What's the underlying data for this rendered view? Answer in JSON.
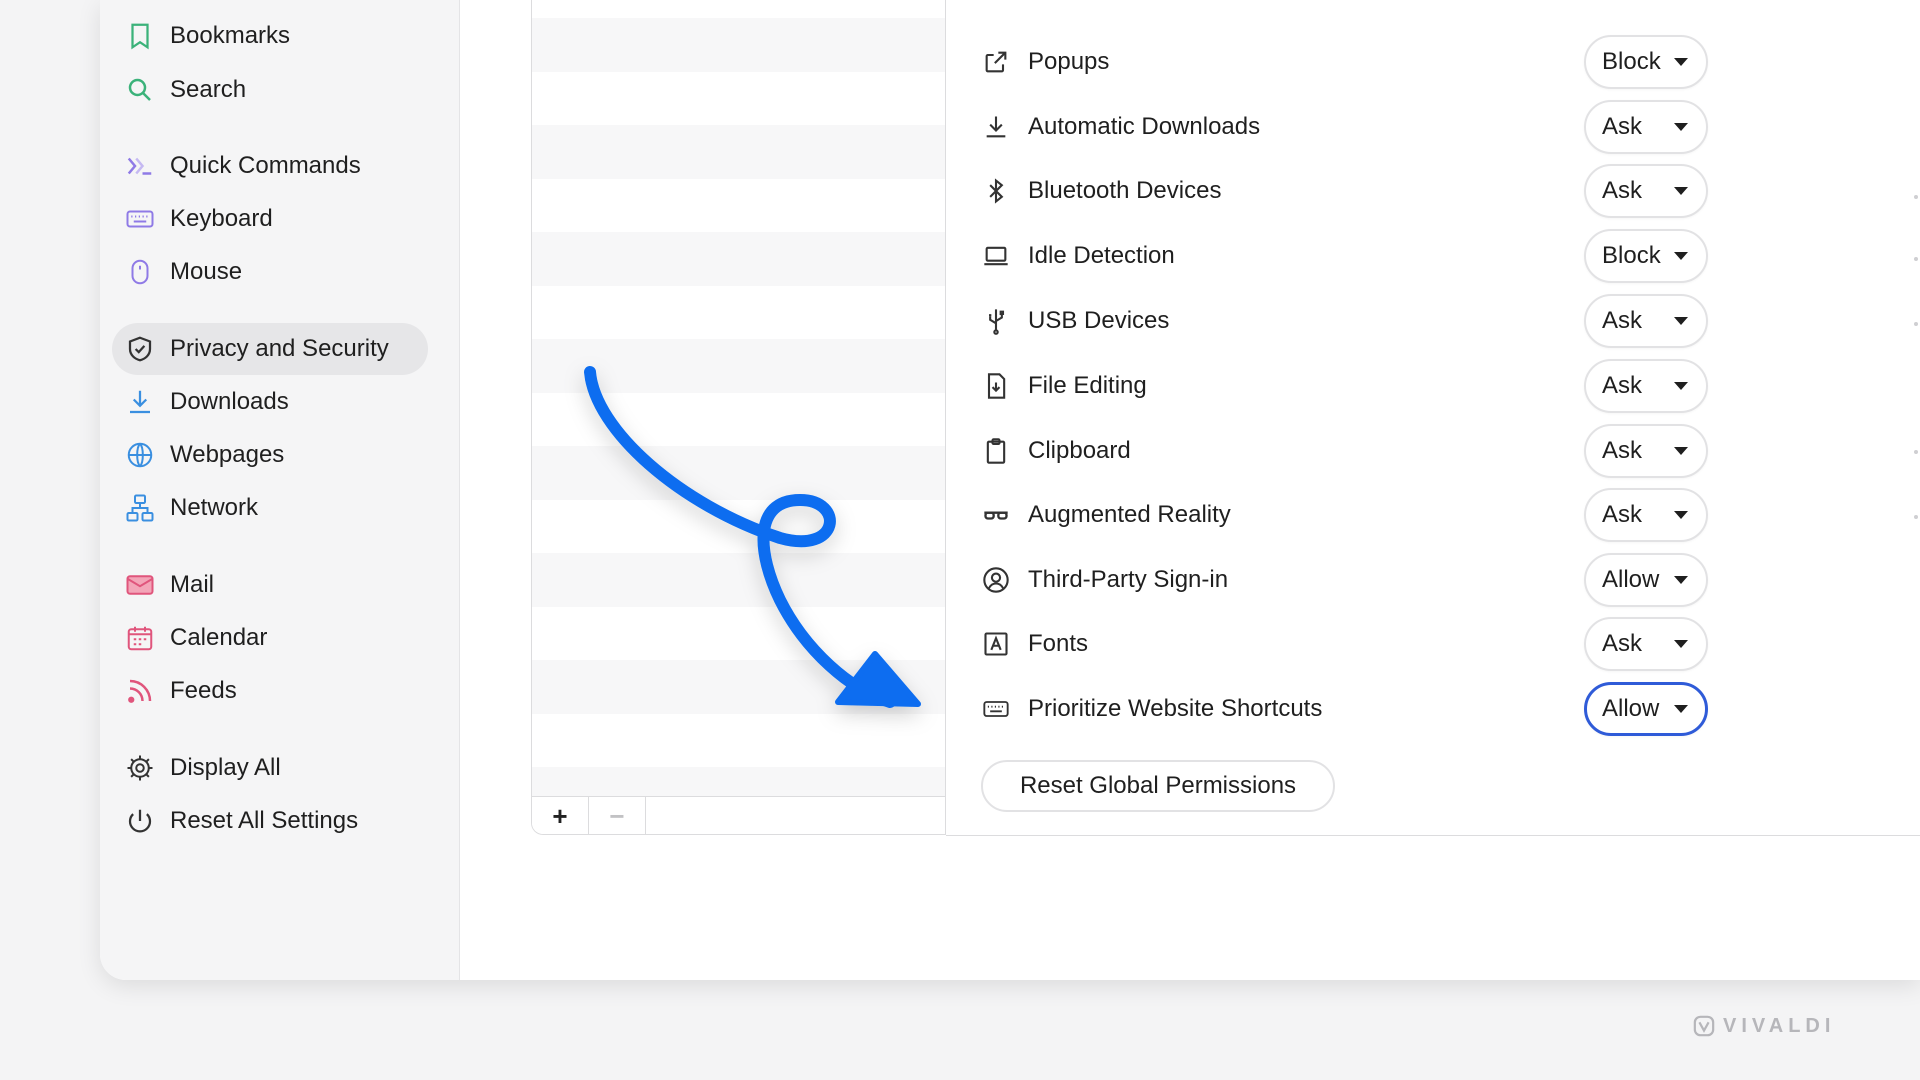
{
  "sidebar": {
    "items": [
      {
        "label": "Bookmarks",
        "icon": "bookmark-icon"
      },
      {
        "label": "Search",
        "icon": "search-icon"
      },
      {
        "label": "Quick Commands",
        "icon": "quick-commands-icon"
      },
      {
        "label": "Keyboard",
        "icon": "keyboard-icon"
      },
      {
        "label": "Mouse",
        "icon": "mouse-icon"
      },
      {
        "label": "Privacy and Security",
        "icon": "shield-icon",
        "active": true
      },
      {
        "label": "Downloads",
        "icon": "download-icon"
      },
      {
        "label": "Webpages",
        "icon": "globe-icon"
      },
      {
        "label": "Network",
        "icon": "network-icon"
      },
      {
        "label": "Mail",
        "icon": "mail-icon"
      },
      {
        "label": "Calendar",
        "icon": "calendar-icon"
      },
      {
        "label": "Feeds",
        "icon": "rss-icon"
      },
      {
        "label": "Display All",
        "icon": "gear-icon"
      },
      {
        "label": "Reset All Settings",
        "icon": "power-icon"
      }
    ]
  },
  "site_list": {
    "add_label": "+",
    "remove_label": "−"
  },
  "permissions": [
    {
      "label": "Popups",
      "value": "Block",
      "icon": "external-link-icon"
    },
    {
      "label": "Automatic Downloads",
      "value": "Ask",
      "icon": "download-icon"
    },
    {
      "label": "Bluetooth Devices",
      "value": "Ask",
      "icon": "bluetooth-icon"
    },
    {
      "label": "Idle Detection",
      "value": "Block",
      "icon": "laptop-icon"
    },
    {
      "label": "USB Devices",
      "value": "Ask",
      "icon": "usb-icon"
    },
    {
      "label": "File Editing",
      "value": "Ask",
      "icon": "file-edit-icon"
    },
    {
      "label": "Clipboard",
      "value": "Ask",
      "icon": "clipboard-icon"
    },
    {
      "label": "Augmented Reality",
      "value": "Ask",
      "icon": "ar-glasses-icon"
    },
    {
      "label": "Third-Party Sign-in",
      "value": "Allow",
      "icon": "user-circle-icon"
    },
    {
      "label": "Fonts",
      "value": "Ask",
      "icon": "font-icon"
    },
    {
      "label": "Prioritize Website Shortcuts",
      "value": "Allow",
      "icon": "keyboard-icon",
      "focused": true
    }
  ],
  "reset_button": "Reset Global Permissions",
  "brand": {
    "name": "VIVALDI"
  },
  "colors": {
    "accent": "#2f5bd8",
    "arrow": "#0a6df0"
  }
}
